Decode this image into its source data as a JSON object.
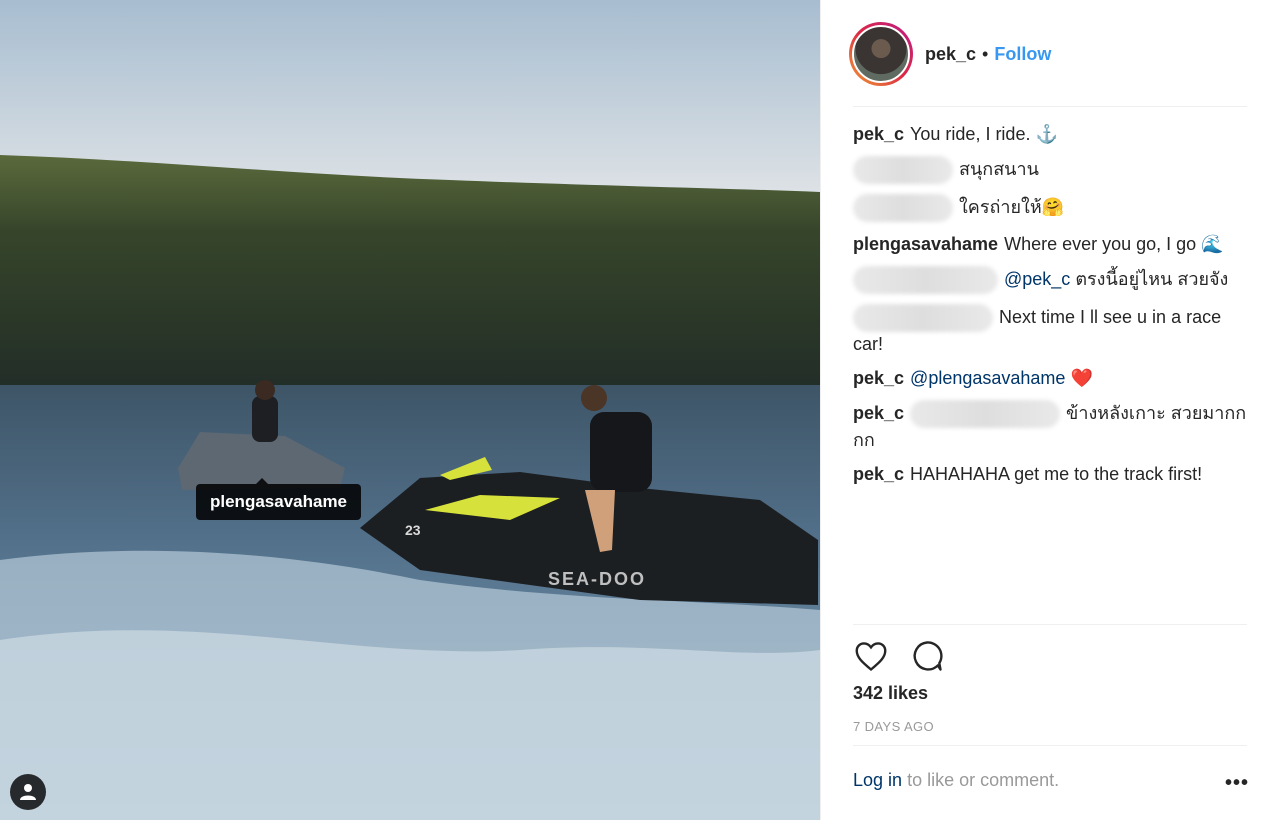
{
  "photo": {
    "tag_label": "plengasavahame",
    "jetski_brand": "SEA-DOO",
    "jetski_number": "23",
    "user_tag_icon": "person-icon"
  },
  "post": {
    "author": "pek_c",
    "separator": "•",
    "follow_label": "Follow",
    "likes": "342 likes",
    "time": "7 DAYS AGO",
    "login_label": "Log in",
    "login_suffix": "to like or comment.",
    "more_label": "•••",
    "icons": {
      "like": "heart-icon",
      "comment": "comment-icon",
      "more": "more-options-icon"
    }
  },
  "comments": [
    {
      "user": "pek_c",
      "text": "You ride, I ride. ⚓"
    },
    {
      "user": "",
      "text": "สนุกสนาน"
    },
    {
      "user": "",
      "text": "ใครถ่ายให้🤗"
    },
    {
      "user": "plengasavahame",
      "text": "Where ever you go, I go 🌊"
    },
    {
      "user": "",
      "mention": "@pek_c",
      "text": "ตรงนี้อยู่ไหน สวยจัง"
    },
    {
      "user": "",
      "text": "Next time I ll see u in a race car!"
    },
    {
      "user": "pek_c",
      "mention": "@plengasavahame",
      "text": "❤️"
    },
    {
      "user": "pek_c",
      "text": "ข้างหลังเกาะ สวยมากกกก"
    },
    {
      "user": "pek_c",
      "text": "HAHAHAHA get me to the track first!"
    }
  ],
  "colors": {
    "accent": "#3897f0",
    "link": "#003569",
    "muted": "#999999"
  }
}
